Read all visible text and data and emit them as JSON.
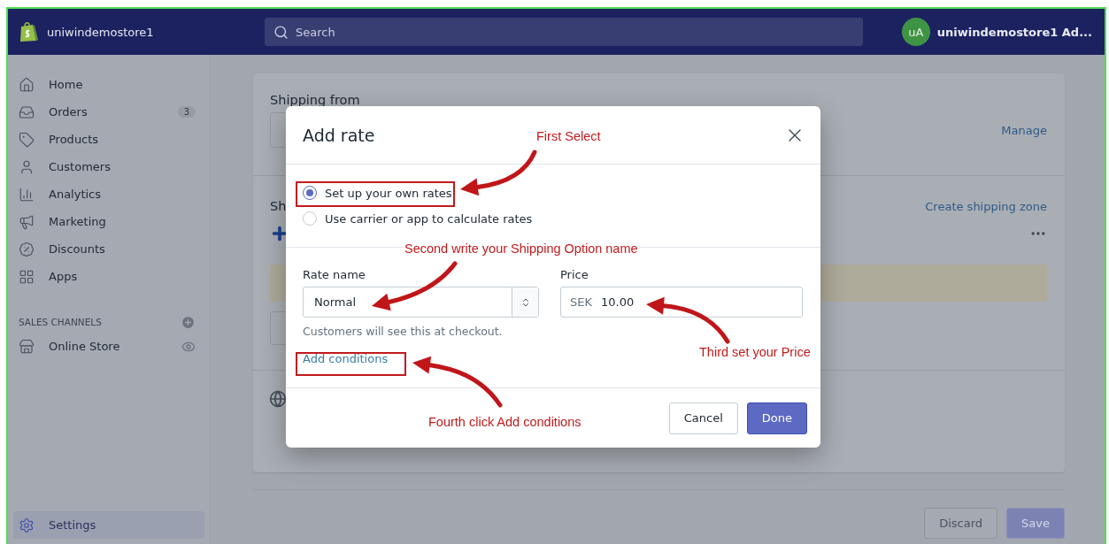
{
  "topbar": {
    "store_name": "uniwindemostore1",
    "search": {
      "placeholder": "Search"
    },
    "account": {
      "initials": "uA",
      "name": "uniwindemostore1 Ad..."
    }
  },
  "sidebar": {
    "items": [
      {
        "kind": "home",
        "label": "Home",
        "selected": false
      },
      {
        "kind": "orders",
        "label": "Orders",
        "badge": "3",
        "selected": false
      },
      {
        "kind": "products",
        "label": "Products",
        "selected": false
      },
      {
        "kind": "customers",
        "label": "Customers",
        "selected": false
      },
      {
        "kind": "analytics",
        "label": "Analytics",
        "selected": false
      },
      {
        "kind": "marketing",
        "label": "Marketing",
        "selected": false
      },
      {
        "kind": "discounts",
        "label": "Discounts",
        "selected": false
      },
      {
        "kind": "apps",
        "label": "Apps",
        "selected": false
      }
    ],
    "channels": {
      "title": "SALES CHANNELS",
      "items": [
        {
          "kind": "store",
          "label": "Online Store",
          "selected": false
        }
      ]
    },
    "footer": {
      "kind": "settings",
      "label": "Settings",
      "selected": true
    }
  },
  "page": {
    "shipping_from": {
      "title": "Shipping from",
      "link": "Manage"
    },
    "zones": {
      "title": "Sh",
      "link": "Create shipping zone"
    },
    "actions": [
      {
        "label": "Discard",
        "disabled": false
      },
      {
        "label": "Save",
        "disabled": true
      }
    ]
  },
  "modal": {
    "title": "Add rate",
    "options": [
      {
        "label": "Set up your own rates",
        "selected": true
      },
      {
        "label": "Use carrier or app to calculate rates",
        "selected": false
      }
    ],
    "rate_name": {
      "label": "Rate name",
      "value": "Normal",
      "help": "Customers will see this at checkout."
    },
    "price": {
      "label": "Price",
      "prefix": "SEK",
      "value": "10.00"
    },
    "link": "Add conditions",
    "buttons": [
      {
        "label": "Cancel",
        "kind": "secondary"
      },
      {
        "label": "Done",
        "kind": "primary"
      }
    ]
  },
  "annotations": [
    {
      "text": "First Select"
    },
    {
      "text": "Second write your Shipping Option name"
    },
    {
      "text": "Third set your Price"
    },
    {
      "text": "Fourth click Add conditions"
    }
  ]
}
